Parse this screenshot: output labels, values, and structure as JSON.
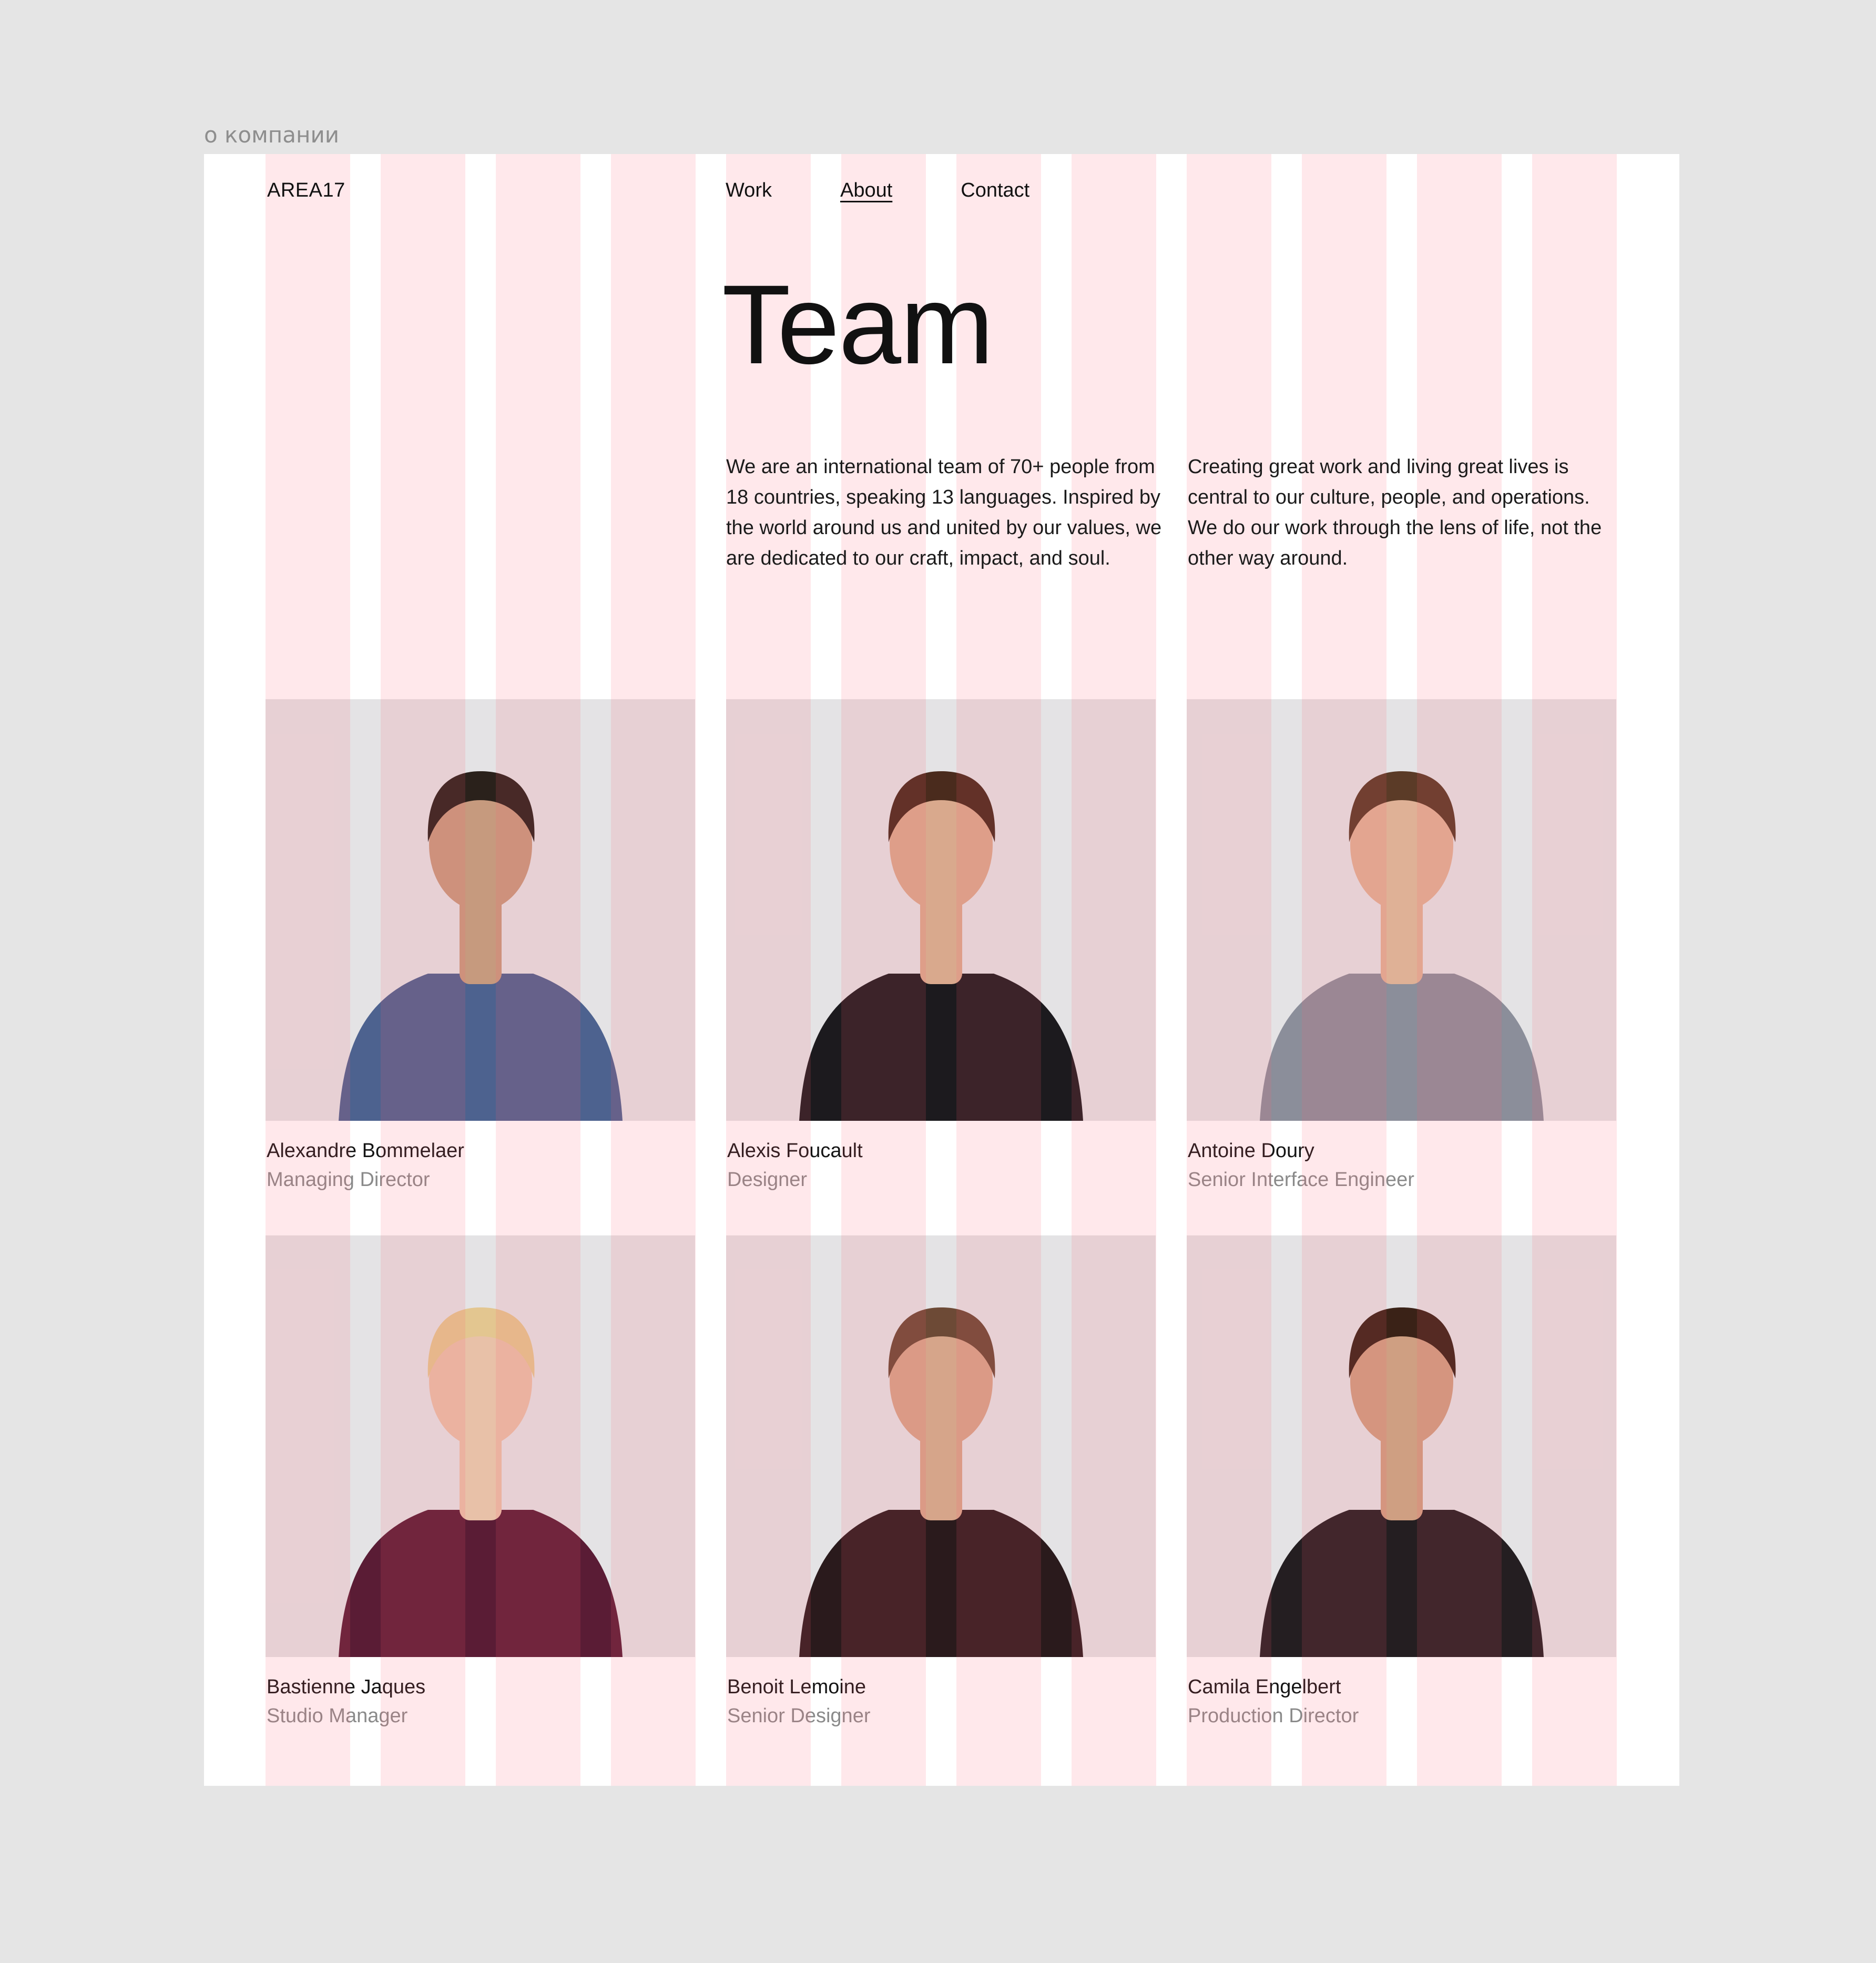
{
  "frame_label": "о компании",
  "header": {
    "logo": "AREA17",
    "nav": [
      {
        "label": "Work",
        "active": false
      },
      {
        "label": "About",
        "active": true
      },
      {
        "label": "Contact",
        "active": false
      }
    ]
  },
  "main": {
    "title": "Team",
    "intro_left": "We are an international team of 70+ people from 18 countries, speaking 13 languages. Inspired by the world around us and united by our values, we are dedicated to our craft, impact, and soul.",
    "intro_right": "Creating great work and living great lives is central to our culture, people, and operations. We do our work through the lens of life, not the other way around."
  },
  "team": [
    {
      "name": "Alexandre Bommelaer",
      "role": "Managing Director",
      "shirt": "#4d628f",
      "hair": "#2a211b",
      "skin": "#c69a7e"
    },
    {
      "name": "Alexis Foucault",
      "role": "Designer",
      "shirt": "#1c1a1e",
      "hair": "#4a2b1d",
      "skin": "#d9a98d"
    },
    {
      "name": "Antoine Doury",
      "role": "Senior Interface Engineer",
      "shirt": "#8b8e9a",
      "hair": "#5b3b27",
      "skin": "#dfb196"
    },
    {
      "name": "Bastienne Jaques",
      "role": "Studio Manager",
      "shirt": "#5a1c35",
      "hair": "#e3c690",
      "skin": "#e8c1a8"
    },
    {
      "name": "Benoit Lemoine",
      "role": "Senior Designer",
      "shirt": "#2a1a1c",
      "hair": "#6d4a36",
      "skin": "#d6a58a"
    },
    {
      "name": "Camila Engelbert",
      "role": "Production Director",
      "shirt": "#241e21",
      "hair": "#3a2217",
      "skin": "#cf9f82"
    }
  ],
  "colors": {
    "background": "#e5e5e5",
    "artboard": "#ffffff",
    "grid_overlay": "#ff5c70",
    "text": "#111111",
    "muted_text": "#8a8a8a",
    "photo_bg": "#e4e3e5"
  }
}
